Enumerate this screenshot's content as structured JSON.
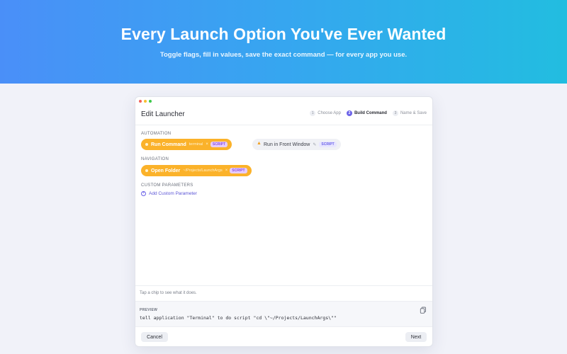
{
  "hero": {
    "title": "Every Launch Option You've Ever Wanted",
    "subtitle": "Toggle flags, fill in values, save the exact command — for every app you use."
  },
  "window": {
    "title": "Edit Launcher",
    "steps": [
      {
        "num": "1",
        "label": "Choose App",
        "active": false
      },
      {
        "num": "2",
        "label": "Build Command",
        "active": true
      },
      {
        "num": "3",
        "label": "Name & Save",
        "active": false
      }
    ]
  },
  "sections": {
    "automation": {
      "label": "AUTOMATION",
      "chips": [
        {
          "label": "Run Command",
          "meta": "terminal",
          "x": "×",
          "tag": "SCRIPT",
          "state": "on"
        },
        {
          "label": "Run in Front Window",
          "pen": "✎",
          "tag": "SCRIPT",
          "state": "off"
        }
      ]
    },
    "navigation": {
      "label": "NAVIGATION",
      "chips": [
        {
          "label": "Open Folder",
          "meta": "~/Projects/LaunchArgs",
          "x": "×",
          "tag": "SCRIPT",
          "state": "on"
        }
      ]
    },
    "custom": {
      "label": "CUSTOM PARAMETERS",
      "add_label": "Add Custom Parameter"
    }
  },
  "hint": "Tap a chip to see what it does.",
  "preview": {
    "label": "PREVIEW",
    "code": "tell application \"Terminal\" to do script \"cd \\\"~/Projects/LaunchArgs\\\"\""
  },
  "footer": {
    "cancel_label": "Cancel",
    "next_label": "Next"
  },
  "colors": {
    "accent": "#6c63e8",
    "chip_on": "#fbb22a"
  }
}
